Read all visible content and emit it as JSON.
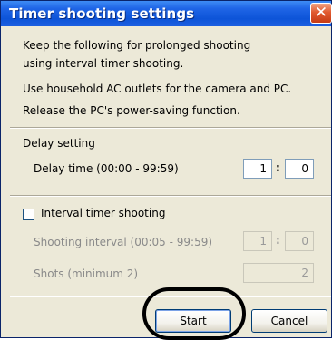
{
  "window": {
    "title": "Timer shooting settings",
    "close_glyph": "✕"
  },
  "intro": {
    "line1": "Keep the following for prolonged shooting",
    "line2": "using interval timer shooting.",
    "line3": "Use household AC outlets for the camera and PC.",
    "line4": "Release the PC's power-saving function."
  },
  "delay": {
    "section_label": "Delay setting",
    "field_label": "Delay time (00:00 - 99:59)",
    "minutes": "1",
    "seconds": "0",
    "separator": ":"
  },
  "interval": {
    "checkbox_label": "Interval timer shooting",
    "checked": false,
    "interval_label": "Shooting interval (00:05 - 99:59)",
    "minutes": "1",
    "seconds": "0",
    "separator": ":",
    "shots_label": "Shots (minimum 2)",
    "shots": "2"
  },
  "buttons": {
    "start": "Start",
    "cancel": "Cancel"
  }
}
